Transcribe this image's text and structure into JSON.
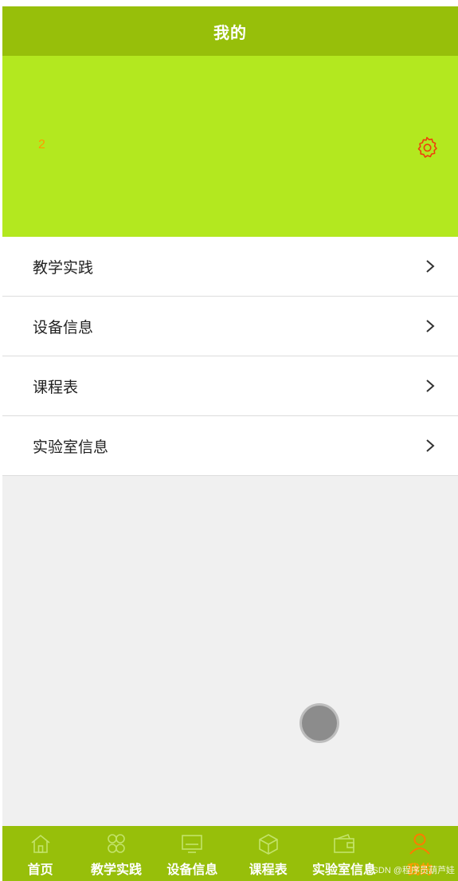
{
  "header": {
    "title": "我的"
  },
  "profile": {
    "username": "2",
    "settings_icon": "gear-icon"
  },
  "menu": {
    "items": [
      {
        "label": "教学实践",
        "icon": "chevron-right-icon"
      },
      {
        "label": "设备信息",
        "icon": "chevron-right-icon"
      },
      {
        "label": "课程表",
        "icon": "chevron-right-icon"
      },
      {
        "label": "实验室信息",
        "icon": "chevron-right-icon"
      }
    ]
  },
  "tabbar": {
    "items": [
      {
        "label": "首页",
        "icon": "home-icon"
      },
      {
        "label": "教学实践",
        "icon": "clover-icon"
      },
      {
        "label": "设备信息",
        "icon": "monitor-icon"
      },
      {
        "label": "课程表",
        "icon": "cube-icon"
      },
      {
        "label": "实验室信息",
        "icon": "wallet-icon"
      },
      {
        "label": "我的",
        "icon": "user-icon",
        "active": true
      }
    ]
  },
  "watermark": "CSDN @程序员葫芦娃",
  "colors": {
    "nav_bg": "#97bf0a",
    "profile_bg": "#b3e81f",
    "accent": "#ff9a00",
    "gear": "#f03c0c",
    "page_bg": "#f0f0f0"
  }
}
